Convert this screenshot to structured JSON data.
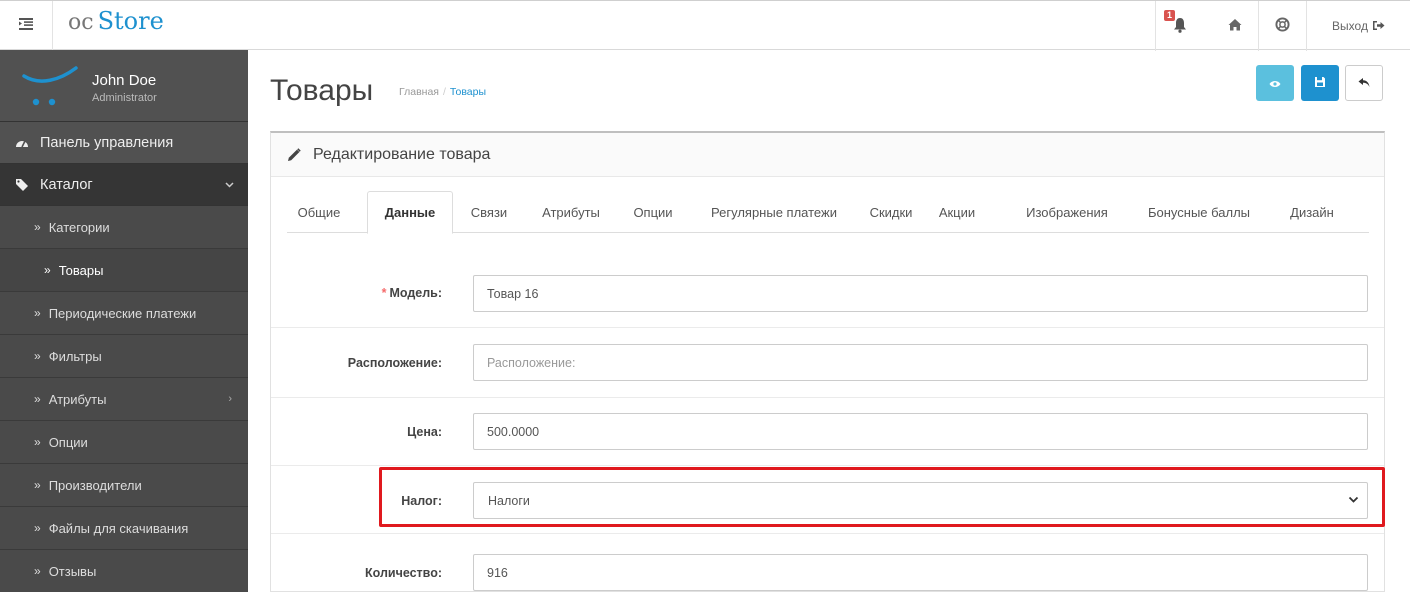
{
  "header": {
    "logo_prefix": "oc",
    "logo_main": "Store",
    "notification_count": "1",
    "logout_label": "Выход"
  },
  "sidebar": {
    "user_name": "John Doe",
    "user_role": "Administrator",
    "dashboard_label": "Панель управления",
    "catalog_label": "Каталог",
    "items": [
      {
        "label": "Категории"
      },
      {
        "label": "Товары"
      },
      {
        "label": "Периодические платежи"
      },
      {
        "label": "Фильтры"
      },
      {
        "label": "Атрибуты"
      },
      {
        "label": "Опции"
      },
      {
        "label": "Производители"
      },
      {
        "label": "Файлы для скачивания"
      },
      {
        "label": "Отзывы"
      }
    ]
  },
  "page": {
    "title": "Товары",
    "breadcrumb_home": "Главная",
    "breadcrumb_sep": "/",
    "breadcrumb_current": "Товары"
  },
  "panel": {
    "heading": "Редактирование товара",
    "tabs": [
      "Общие",
      "Данные",
      "Связи",
      "Атрибуты",
      "Опции",
      "Регулярные платежи",
      "Скидки",
      "Акции",
      "Изображения",
      "Бонусные баллы",
      "Дизайн"
    ],
    "active_tab": "Данные"
  },
  "form": {
    "model": {
      "label": "Модель:",
      "required_mark": "*",
      "value": "Товар 16"
    },
    "location": {
      "label": "Расположение:",
      "placeholder": "Расположение:"
    },
    "price": {
      "label": "Цена:",
      "value": "500.0000"
    },
    "tax": {
      "label": "Налог:",
      "selected": "Налоги"
    },
    "quantity": {
      "label": "Количество:",
      "value": "916"
    }
  },
  "colors": {
    "accent": "#1e91cf",
    "preview_button": "#5bc0de",
    "save_button": "#1e91cf",
    "highlight": "#e0191e",
    "badge": "#d9534f"
  }
}
